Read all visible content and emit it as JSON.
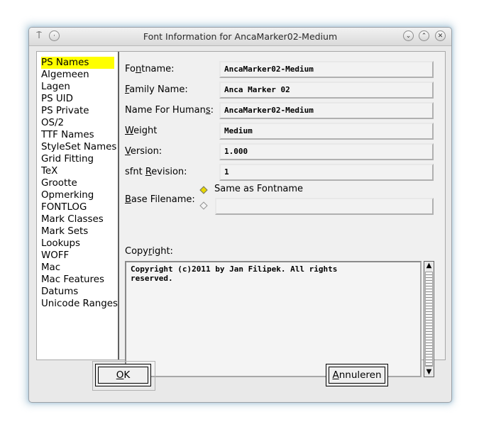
{
  "window": {
    "title": "Font Information for AncaMarker02-Medium"
  },
  "sidebar": {
    "items": [
      {
        "label": "PS Names",
        "selected": true
      },
      {
        "label": "Algemeen"
      },
      {
        "label": "Lagen"
      },
      {
        "label": "PS UID"
      },
      {
        "label": "PS Private"
      },
      {
        "label": "OS/2"
      },
      {
        "label": "TTF Names"
      },
      {
        "label": "StyleSet Names"
      },
      {
        "label": "Grid Fitting"
      },
      {
        "label": "TeX"
      },
      {
        "label": "Grootte"
      },
      {
        "label": "Opmerking"
      },
      {
        "label": "FONTLOG"
      },
      {
        "label": "Mark Classes"
      },
      {
        "label": "Mark Sets"
      },
      {
        "label": "Lookups"
      },
      {
        "label": "WOFF"
      },
      {
        "label": "Mac"
      },
      {
        "label": "Mac Features"
      },
      {
        "label": "Datums"
      },
      {
        "label": "Unicode Ranges"
      }
    ]
  },
  "form": {
    "fontname": {
      "label_pre": "Fo",
      "label_u": "n",
      "label_post": "tname:",
      "value": "AncaMarker02-Medium"
    },
    "family": {
      "label_pre": "",
      "label_u": "F",
      "label_post": "amily Name:",
      "value": "Anca Marker 02"
    },
    "humans": {
      "label_pre": "Name For Human",
      "label_u": "s",
      "label_post": ":",
      "value": "AncaMarker02-Medium"
    },
    "weight": {
      "label_pre": "",
      "label_u": "W",
      "label_post": "eight",
      "value": "Medium"
    },
    "version": {
      "label_pre": "",
      "label_u": "V",
      "label_post": "ersion:",
      "value": "1.000"
    },
    "sfnt": {
      "label_pre": "sfnt ",
      "label_u": "R",
      "label_post": "evision:",
      "value": "1"
    },
    "base_filename": {
      "label_pre": "",
      "label_u": "B",
      "label_post": "ase Filename:",
      "same_as_label": "Same as Fontname",
      "custom_value": ""
    },
    "copyright": {
      "label_pre": "Copy",
      "label_u": "r",
      "label_post": "ight:",
      "value": "Copyright (c)2011 by Jan Filipek. All rights\nreserved."
    }
  },
  "buttons": {
    "ok_u": "O",
    "ok_post": "K",
    "cancel_u": "A",
    "cancel_post": "nnuleren"
  },
  "colors": {
    "selected_bg": "#ffff00",
    "radio_selected": "#e8d800"
  }
}
